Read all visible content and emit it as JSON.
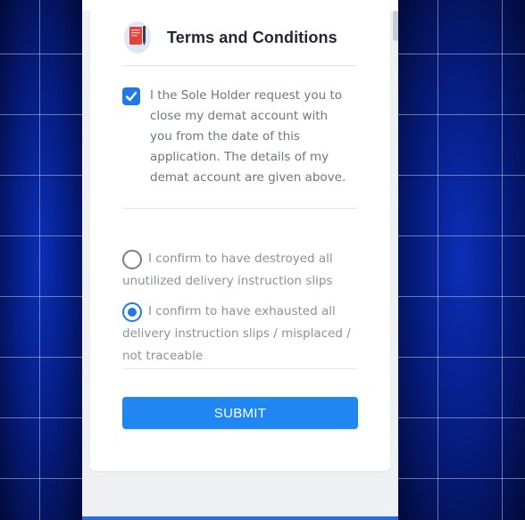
{
  "card": {
    "title": "Terms and Conditions"
  },
  "declaration": {
    "checked": true,
    "text": "I the Sole Holder request you to close my demat account with you from the date of this application. The details of my demat account are given above."
  },
  "slip_options": [
    {
      "selected": false,
      "line1": "I confirm to have destroyed all",
      "rest": "unutilized delivery instruction slips"
    },
    {
      "selected": true,
      "line1": "I confirm to have exhausted all",
      "rest": "delivery instruction slips / misplaced / not traceable"
    }
  ],
  "submit": {
    "label": "SUBMIT"
  },
  "colors": {
    "accent": "#1f86f2",
    "checkbox": "#1f7ae8",
    "title": "#1f2733",
    "muted_text": "#8c919a"
  },
  "icons": {
    "title_icon": "document-pen-icon",
    "check_icon": "checkmark-icon"
  }
}
